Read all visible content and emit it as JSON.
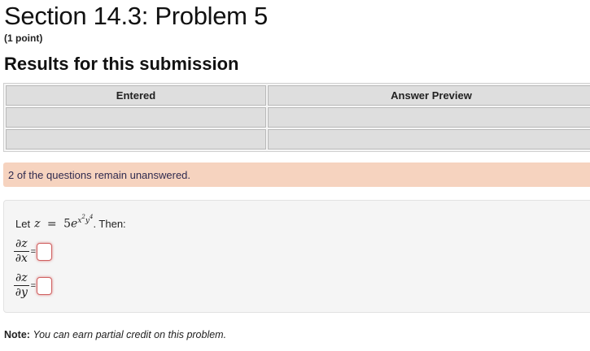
{
  "page": {
    "title": "Section 14.3: Problem 5",
    "points": "(1 point)"
  },
  "results": {
    "heading": "Results for this submission",
    "columns": [
      "Entered",
      "Answer Preview"
    ],
    "rows": [
      [
        "",
        ""
      ],
      [
        "",
        ""
      ]
    ]
  },
  "alert": {
    "text": "2 of the questions remain unanswered."
  },
  "problem": {
    "intro_prefix": "Let",
    "intro_suffix": ". Then:",
    "equation": {
      "lhs": "z",
      "equals": "=",
      "coef": "5",
      "base": "e",
      "exp_x": "x",
      "exp_x_pow": "2",
      "exp_y": "y",
      "exp_y_pow": "4"
    },
    "derivatives": [
      {
        "num": "∂z",
        "den": "∂x",
        "eq": "=",
        "value": ""
      },
      {
        "num": "∂z",
        "den": "∂y",
        "eq": "=",
        "value": ""
      }
    ]
  },
  "note": {
    "label": "Note:",
    "text": "You can earn partial credit on this problem."
  }
}
